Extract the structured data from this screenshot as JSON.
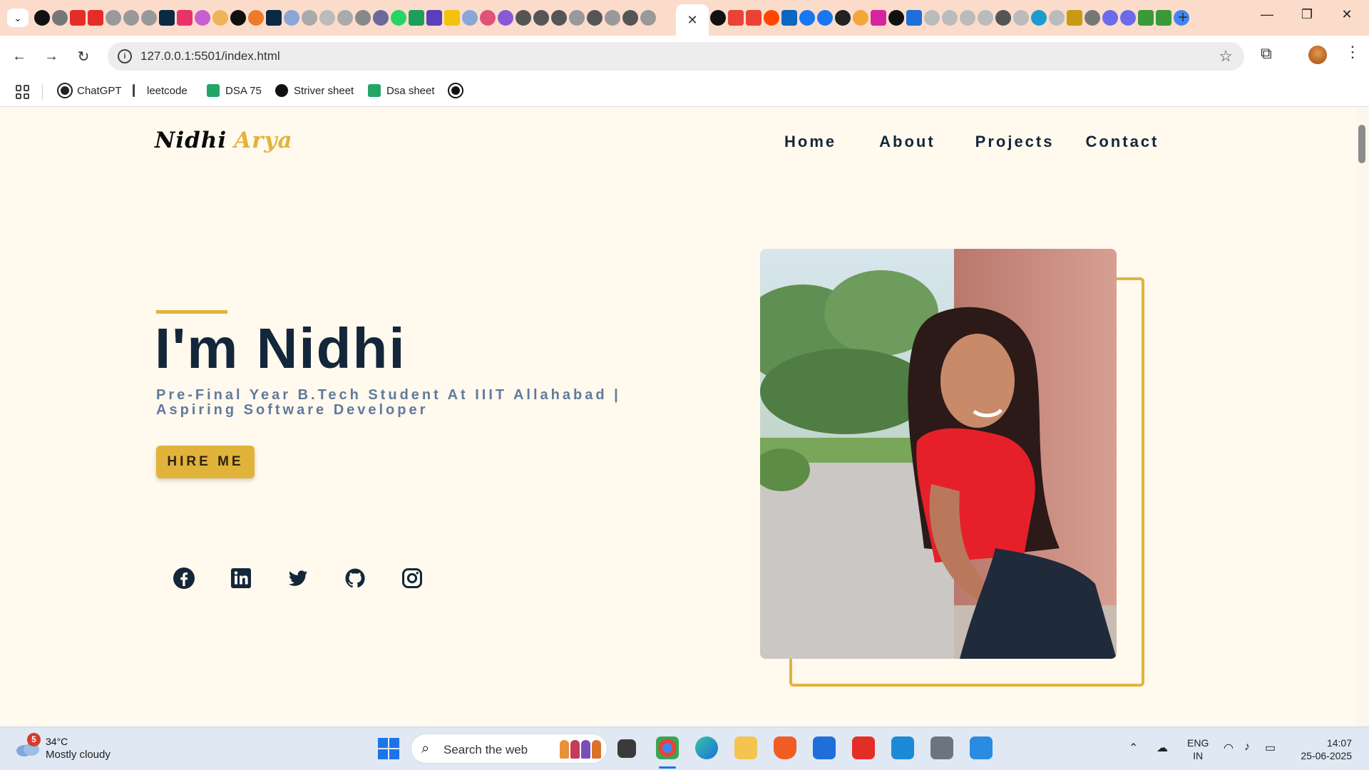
{
  "browser": {
    "url": "127.0.0.1:5501/index.html",
    "active_tab_close": "✕",
    "new_tab": "+",
    "window_controls": [
      "—",
      "❐",
      "✕"
    ],
    "bookmarks": [
      {
        "label": "ChatGPT",
        "icon": "chatgpt-icon",
        "color": "#222222"
      },
      {
        "label": "leetcode",
        "icon": "leetcode-icon",
        "color": "#444444"
      },
      {
        "label": "DSA 75",
        "icon": "sheets-icon",
        "color": "#23a566"
      },
      {
        "label": "Striver sheet",
        "icon": "tuf-icon",
        "color": "#111111"
      },
      {
        "label": "Dsa sheet",
        "icon": "sheets-icon",
        "color": "#23a566"
      }
    ]
  },
  "site": {
    "logo_first": "Nidhi",
    "logo_second": "Arya",
    "nav": [
      "Home",
      "About",
      "Projects",
      "Contact"
    ],
    "hero_title": "I'm Nidhi",
    "hero_subtitle": "Pre-Final Year B.Tech Student At IIIT Allahabad | Aspiring Software Developer",
    "hire_button": "HIRE ME",
    "socials": [
      "facebook-icon",
      "linkedin-icon",
      "twitter-icon",
      "github-icon",
      "instagram-icon"
    ],
    "colors": {
      "accent": "#e2b33a",
      "navy": "#14263a",
      "subtitle": "#607a9c",
      "background": "#fff9ee"
    }
  },
  "taskbar": {
    "weather_badge": "5",
    "temperature": "34°C",
    "condition": "Mostly cloudy",
    "search_placeholder": "Search the web",
    "language_line1": "ENG",
    "language_line2": "IN",
    "time": "14:07",
    "date": "25-06-2025"
  }
}
